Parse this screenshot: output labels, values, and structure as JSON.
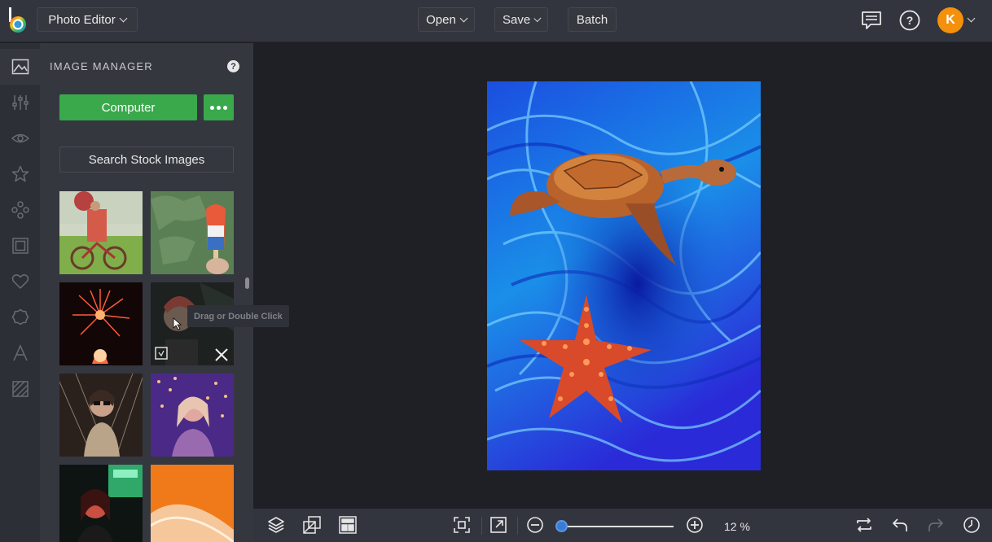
{
  "topbar": {
    "app_menu_label": "Photo Editor",
    "open_label": "Open",
    "save_label": "Save",
    "batch_label": "Batch",
    "avatar_initial": "K"
  },
  "rail": {
    "icons": [
      "image-icon",
      "sliders-icon",
      "eye-icon",
      "star-icon",
      "effects-icon",
      "frame-icon",
      "heart-icon",
      "badge-icon",
      "text-icon",
      "texture-icon"
    ]
  },
  "image_manager": {
    "title": "IMAGE MANAGER",
    "help": "?",
    "computer_label": "Computer",
    "stock_label": "Search Stock Images",
    "tooltip": "Drag or Double Click",
    "thumbnails": [
      "girl-on-bicycle",
      "popsicle",
      "fireworks",
      "woman-portrait",
      "woman-sunglasses-lights",
      "woman-neon-lights",
      "woman-neon-bar",
      "orange-abstract"
    ]
  },
  "bottombar": {
    "zoom_label": "12 %",
    "zoom_value": 0.12
  },
  "colors": {
    "accent_green": "#3aa94b",
    "avatar_orange": "#f5900b",
    "zoom_blue": "#3a7bd5"
  }
}
